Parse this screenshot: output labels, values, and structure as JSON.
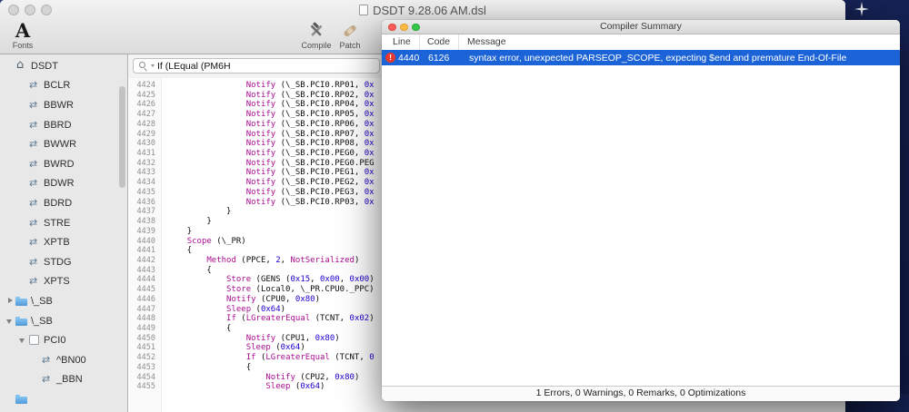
{
  "desktop": {
    "background": "#1b2a63"
  },
  "main_window": {
    "title": "DSDT 9.28.06 AM.dsl",
    "toolbar": {
      "fonts_glyph": "A",
      "fonts_label": "Fonts",
      "compile_label": "Compile",
      "patch_label": "Patch"
    },
    "search": {
      "value": "If (LEqual (PM6H"
    },
    "sidebar": {
      "items": [
        {
          "label": "DSDT",
          "icon": "house",
          "level": 0
        },
        {
          "label": "BCLR",
          "icon": "method",
          "level": 1
        },
        {
          "label": "BBWR",
          "icon": "method",
          "level": 1
        },
        {
          "label": "BBRD",
          "icon": "method",
          "level": 1
        },
        {
          "label": "BWWR",
          "icon": "method",
          "level": 1
        },
        {
          "label": "BWRD",
          "icon": "method",
          "level": 1
        },
        {
          "label": "BDWR",
          "icon": "method",
          "level": 1
        },
        {
          "label": "BDRD",
          "icon": "method",
          "level": 1
        },
        {
          "label": "STRE",
          "icon": "method",
          "level": 1
        },
        {
          "label": "XPTB",
          "icon": "method",
          "level": 1
        },
        {
          "label": "STDG",
          "icon": "method",
          "level": 1
        },
        {
          "label": "XPTS",
          "icon": "method",
          "level": 1
        },
        {
          "label": "\\_SB",
          "icon": "folder",
          "level": 0,
          "disclosure": "collapsed"
        },
        {
          "label": "\\_SB",
          "icon": "folder",
          "level": 0,
          "disclosure": "expanded"
        },
        {
          "label": "PCI0",
          "icon": "device",
          "level": 1,
          "disclosure": "expanded"
        },
        {
          "label": "^BN00",
          "icon": "method",
          "level": 2
        },
        {
          "label": "_BBN",
          "icon": "method",
          "level": 2
        },
        {
          "label": "",
          "icon": "folder",
          "level": 0
        }
      ]
    },
    "editor": {
      "lines": [
        {
          "n": "4424",
          "s": [
            [
              "                ",
              "p"
            ],
            [
              "Notify",
              "k"
            ],
            [
              " (\\_SB.PCI0.RP01, ",
              "p"
            ],
            [
              "0x",
              "n"
            ]
          ]
        },
        {
          "n": "4425",
          "s": [
            [
              "                ",
              "p"
            ],
            [
              "Notify",
              "k"
            ],
            [
              " (\\_SB.PCI0.RP02, ",
              "p"
            ],
            [
              "0x",
              "n"
            ]
          ]
        },
        {
          "n": "4426",
          "s": [
            [
              "                ",
              "p"
            ],
            [
              "Notify",
              "k"
            ],
            [
              " (\\_SB.PCI0.RP04, ",
              "p"
            ],
            [
              "0x",
              "n"
            ]
          ]
        },
        {
          "n": "4427",
          "s": [
            [
              "                ",
              "p"
            ],
            [
              "Notify",
              "k"
            ],
            [
              " (\\_SB.PCI0.RP05, ",
              "p"
            ],
            [
              "0x",
              "n"
            ]
          ]
        },
        {
          "n": "4428",
          "s": [
            [
              "                ",
              "p"
            ],
            [
              "Notify",
              "k"
            ],
            [
              " (\\_SB.PCI0.RP06, ",
              "p"
            ],
            [
              "0x",
              "n"
            ]
          ]
        },
        {
          "n": "4429",
          "s": [
            [
              "                ",
              "p"
            ],
            [
              "Notify",
              "k"
            ],
            [
              " (\\_SB.PCI0.RP07, ",
              "p"
            ],
            [
              "0x",
              "n"
            ]
          ]
        },
        {
          "n": "4430",
          "s": [
            [
              "                ",
              "p"
            ],
            [
              "Notify",
              "k"
            ],
            [
              " (\\_SB.PCI0.RP08, ",
              "p"
            ],
            [
              "0x",
              "n"
            ]
          ]
        },
        {
          "n": "4431",
          "s": [
            [
              "                ",
              "p"
            ],
            [
              "Notify",
              "k"
            ],
            [
              " (\\_SB.PCI0.PEG0, ",
              "p"
            ],
            [
              "0x",
              "n"
            ]
          ]
        },
        {
          "n": "4432",
          "s": [
            [
              "                ",
              "p"
            ],
            [
              "Notify",
              "k"
            ],
            [
              " (\\_SB.PCI0.PEG0.PEG",
              "p"
            ]
          ]
        },
        {
          "n": "4433",
          "s": [
            [
              "                ",
              "p"
            ],
            [
              "Notify",
              "k"
            ],
            [
              " (\\_SB.PCI0.PEG1, ",
              "p"
            ],
            [
              "0x",
              "n"
            ]
          ]
        },
        {
          "n": "4434",
          "s": [
            [
              "                ",
              "p"
            ],
            [
              "Notify",
              "k"
            ],
            [
              " (\\_SB.PCI0.PEG2, ",
              "p"
            ],
            [
              "0x",
              "n"
            ]
          ]
        },
        {
          "n": "4435",
          "s": [
            [
              "                ",
              "p"
            ],
            [
              "Notify",
              "k"
            ],
            [
              " (\\_SB.PCI0.PEG3, ",
              "p"
            ],
            [
              "0x",
              "n"
            ]
          ]
        },
        {
          "n": "4436",
          "s": [
            [
              "                ",
              "p"
            ],
            [
              "Notify",
              "k"
            ],
            [
              " (\\_SB.PCI0.RP03, ",
              "p"
            ],
            [
              "0x",
              "n"
            ]
          ]
        },
        {
          "n": "4437",
          "s": [
            [
              "            }",
              "p"
            ]
          ]
        },
        {
          "n": "4438",
          "s": [
            [
              "        }",
              "p"
            ]
          ]
        },
        {
          "n": "4439",
          "s": [
            [
              "    }",
              "p"
            ]
          ]
        },
        {
          "n": "4440",
          "s": [
            [
              "    ",
              "p"
            ],
            [
              "Scope",
              "k"
            ],
            [
              " (\\_PR)",
              "p"
            ]
          ]
        },
        {
          "n": "4441",
          "s": [
            [
              "    {",
              "p"
            ]
          ]
        },
        {
          "n": "4442",
          "s": [
            [
              "        ",
              "p"
            ],
            [
              "Method",
              "k"
            ],
            [
              " (PPCE, ",
              "p"
            ],
            [
              "2",
              "n"
            ],
            [
              ", ",
              "p"
            ],
            [
              "NotSerialized",
              "k"
            ],
            [
              ")",
              "p"
            ]
          ]
        },
        {
          "n": "4443",
          "s": [
            [
              "        {",
              "p"
            ]
          ]
        },
        {
          "n": "4444",
          "s": [
            [
              "            ",
              "p"
            ],
            [
              "Store",
              "k"
            ],
            [
              " (GENS (",
              "p"
            ],
            [
              "0x15",
              "n"
            ],
            [
              ", ",
              "p"
            ],
            [
              "0x00",
              "n"
            ],
            [
              ", ",
              "p"
            ],
            [
              "0x00",
              "n"
            ],
            [
              ")",
              "p"
            ]
          ]
        },
        {
          "n": "4445",
          "s": [
            [
              "            ",
              "p"
            ],
            [
              "Store",
              "k"
            ],
            [
              " (Local0, \\_PR.CPU0._PPC)",
              "p"
            ]
          ]
        },
        {
          "n": "4446",
          "s": [
            [
              "            ",
              "p"
            ],
            [
              "Notify",
              "k"
            ],
            [
              " (CPU0, ",
              "p"
            ],
            [
              "0x80",
              "n"
            ],
            [
              ")",
              "p"
            ]
          ]
        },
        {
          "n": "4447",
          "s": [
            [
              "            ",
              "p"
            ],
            [
              "Sleep",
              "k"
            ],
            [
              " (",
              "p"
            ],
            [
              "0x64",
              "n"
            ],
            [
              ")",
              "p"
            ]
          ]
        },
        {
          "n": "4448",
          "s": [
            [
              "            ",
              "p"
            ],
            [
              "If",
              "k"
            ],
            [
              " (",
              "p"
            ],
            [
              "LGreaterEqual",
              "k"
            ],
            [
              " (TCNT, ",
              "p"
            ],
            [
              "0x02",
              "n"
            ],
            [
              ")",
              "p"
            ]
          ]
        },
        {
          "n": "4449",
          "s": [
            [
              "            {",
              "p"
            ]
          ]
        },
        {
          "n": "4450",
          "s": [
            [
              "                ",
              "p"
            ],
            [
              "Notify",
              "k"
            ],
            [
              " (CPU1, ",
              "p"
            ],
            [
              "0x80",
              "n"
            ],
            [
              ")",
              "p"
            ]
          ]
        },
        {
          "n": "4451",
          "s": [
            [
              "                ",
              "p"
            ],
            [
              "Sleep",
              "k"
            ],
            [
              " (",
              "p"
            ],
            [
              "0x64",
              "n"
            ],
            [
              ")",
              "p"
            ]
          ]
        },
        {
          "n": "4452",
          "s": [
            [
              "                ",
              "p"
            ],
            [
              "If",
              "k"
            ],
            [
              " (",
              "p"
            ],
            [
              "LGreaterEqual",
              "k"
            ],
            [
              " (TCNT, ",
              "p"
            ],
            [
              "0",
              "n"
            ]
          ]
        },
        {
          "n": "4453",
          "s": [
            [
              "                {",
              "p"
            ]
          ]
        },
        {
          "n": "4454",
          "s": [
            [
              "                    ",
              "p"
            ],
            [
              "Notify",
              "k"
            ],
            [
              " (CPU2, ",
              "p"
            ],
            [
              "0x80",
              "n"
            ],
            [
              ")",
              "p"
            ]
          ]
        },
        {
          "n": "4455",
          "s": [
            [
              "                    ",
              "p"
            ],
            [
              "Sleep",
              "k"
            ],
            [
              " (",
              "p"
            ],
            [
              "0x64",
              "n"
            ],
            [
              ")",
              "p"
            ]
          ]
        }
      ]
    }
  },
  "compiler_window": {
    "title": "Compiler Summary",
    "columns": [
      "Line",
      "Code",
      "Message"
    ],
    "error_icon_glyph": "!",
    "rows": [
      {
        "line": "4440",
        "code": "6126",
        "message": "syntax error, unexpected PARSEOP_SCOPE, expecting $end and premature End-Of-File"
      }
    ],
    "status": "1 Errors, 0 Warnings, 0 Remarks, 0 Optimizations",
    "colors": {
      "selection": "#1b63d6",
      "error": "#e8392f"
    }
  }
}
